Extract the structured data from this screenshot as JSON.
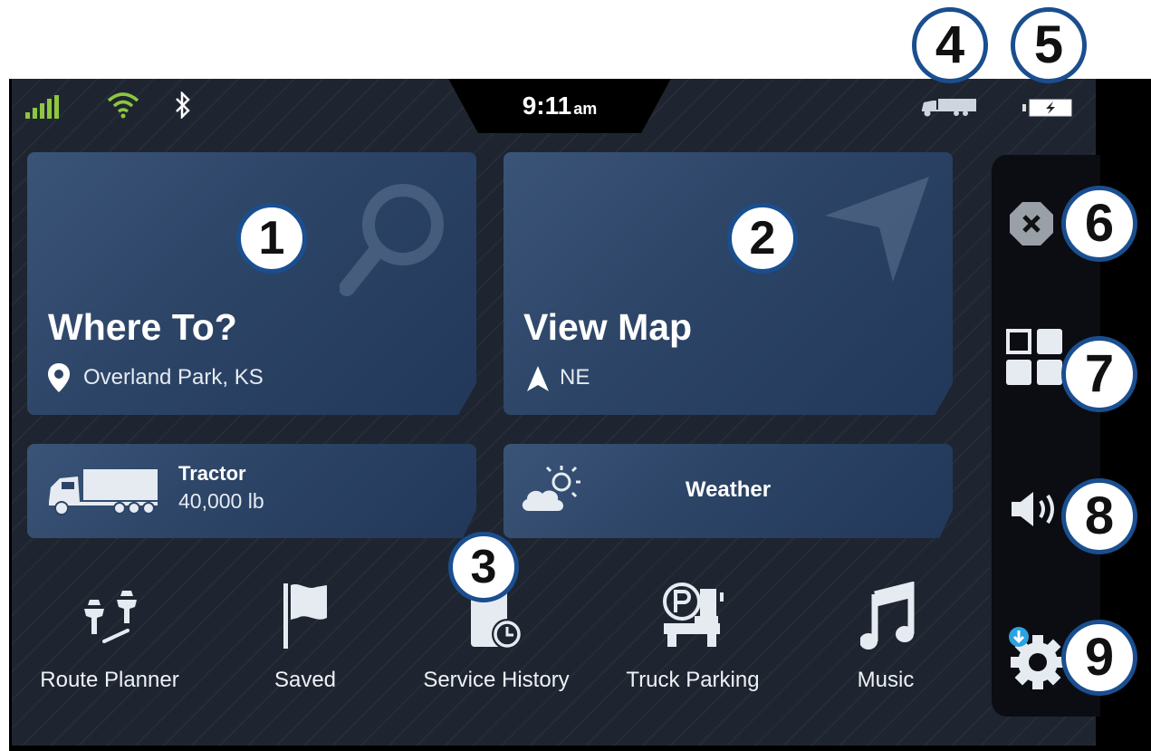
{
  "status": {
    "time": "9:11",
    "ampm": "am"
  },
  "where_to": {
    "title": "Where To?",
    "location": "Overland Park, KS"
  },
  "view_map": {
    "title": "View Map",
    "heading": "NE"
  },
  "vehicle": {
    "name": "Tractor",
    "weight": "40,000 lb"
  },
  "weather": {
    "label": "Weather"
  },
  "shortcuts": [
    {
      "label": "Route Planner",
      "icon": "pins-icon"
    },
    {
      "label": "Saved",
      "icon": "flag-icon"
    },
    {
      "label": "Service History",
      "icon": "service-history-icon"
    },
    {
      "label": "Truck Parking",
      "icon": "truck-parking-icon"
    },
    {
      "label": "Music",
      "icon": "music-note-icon"
    }
  ],
  "callouts": [
    "1",
    "2",
    "3",
    "4",
    "5",
    "6",
    "7",
    "8",
    "9"
  ],
  "colors": {
    "signal": "#8dc63f",
    "callout_border": "#1a4e8f",
    "card": "#2c4466"
  }
}
